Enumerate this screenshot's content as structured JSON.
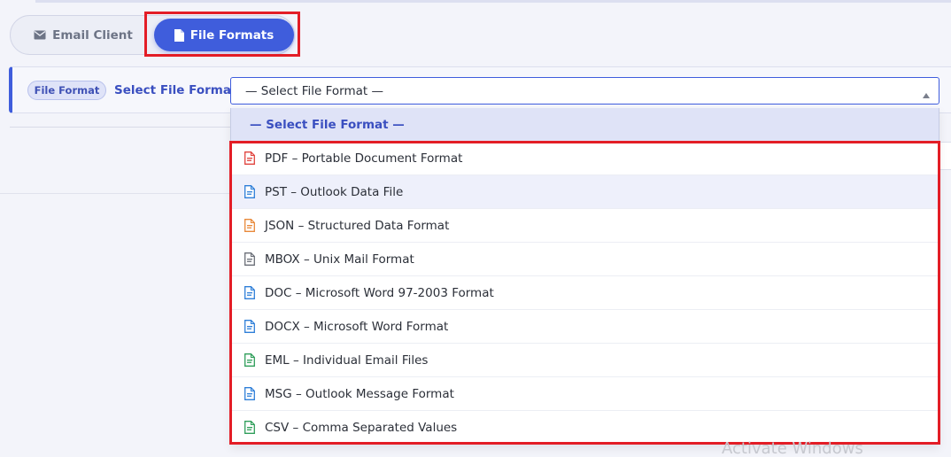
{
  "tabs": {
    "email_client_label": "Email Client",
    "file_formats_label": "File Formats",
    "active": "File Formats"
  },
  "selector": {
    "badge": "File Format",
    "label": "Select File Format:",
    "current_value": "— Select File Format —"
  },
  "dropdown": {
    "header": "— Select File Format —",
    "options": [
      {
        "label": "PDF – Portable Document Format",
        "icon": "pdf-file-icon",
        "color": "#e0443e"
      },
      {
        "label": "PST – Outlook Data File",
        "icon": "pst-file-icon",
        "color": "#2f7fd8"
      },
      {
        "label": "JSON – Structured Data Format",
        "icon": "json-file-icon",
        "color": "#e8893a"
      },
      {
        "label": "MBOX – Unix Mail Format",
        "icon": "mbox-file-icon",
        "color": "#6b6f78"
      },
      {
        "label": "DOC – Microsoft Word 97-2003 Format",
        "icon": "doc-file-icon",
        "color": "#2f7fd8"
      },
      {
        "label": "DOCX – Microsoft Word Format",
        "icon": "docx-file-icon",
        "color": "#2f7fd8"
      },
      {
        "label": "EML – Individual Email Files",
        "icon": "eml-file-icon",
        "color": "#2f9e5a"
      },
      {
        "label": "MSG – Outlook Message Format",
        "icon": "msg-file-icon",
        "color": "#2f7fd8"
      },
      {
        "label": "CSV – Comma Separated Values",
        "icon": "csv-file-icon",
        "color": "#2f9e5a"
      }
    ],
    "hovered_index": 1
  },
  "watermark": "Activate Windows",
  "colors": {
    "accent": "#3f5ddc",
    "highlight": "#e31d26"
  }
}
